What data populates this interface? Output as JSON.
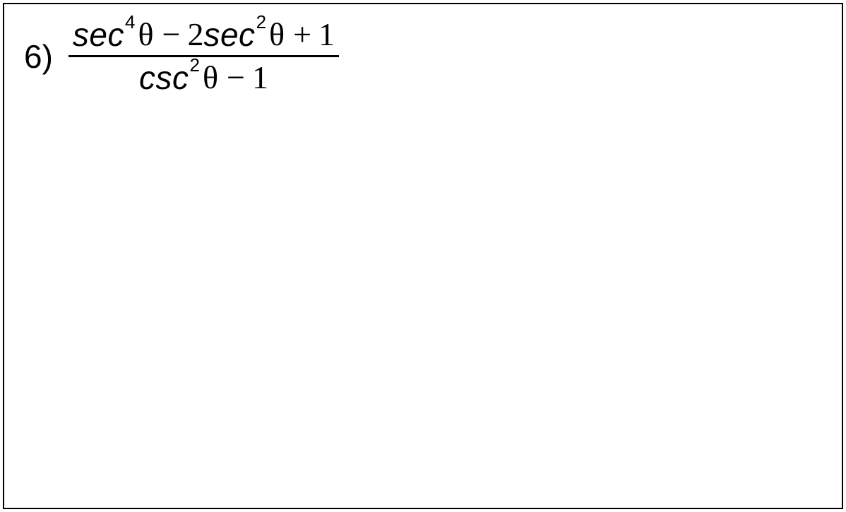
{
  "problem": {
    "number": "6)",
    "expression": {
      "numerator": {
        "term1_fn": "sec",
        "term1_exp": "4",
        "term1_var": "θ",
        "op1": "−",
        "term2_coeff": "2",
        "term2_fn": "sec",
        "term2_exp": "2",
        "term2_var": "θ",
        "op2": "+",
        "term3": "1"
      },
      "denominator": {
        "term1_fn": "csc",
        "term1_exp": "2",
        "term1_var": "θ",
        "op1": "−",
        "term2": "1"
      }
    }
  }
}
